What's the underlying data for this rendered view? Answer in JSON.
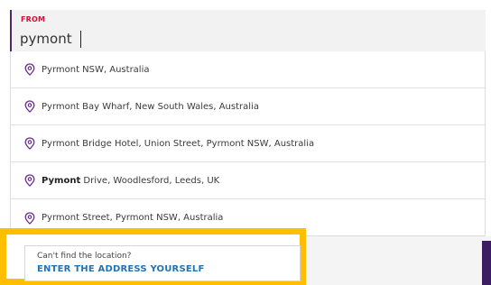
{
  "from": {
    "label": "FROM",
    "value": "pymont"
  },
  "suggestions": [
    {
      "bold": "",
      "text": "Pyrmont NSW, Australia"
    },
    {
      "bold": "",
      "text": "Pyrmont Bay Wharf, New South Wales, Australia"
    },
    {
      "bold": "",
      "text": "Pyrmont Bridge Hotel, Union Street, Pyrmont NSW, Australia"
    },
    {
      "bold": "Pymont",
      "text": " Drive, Woodlesford, Leeds, UK"
    },
    {
      "bold": "",
      "text": "Pyrmont Street, Pyrmont NSW, Australia"
    }
  ],
  "fallback": {
    "prompt": "Can't find the location?",
    "link": "ENTER THE ADDRESS YOURSELF"
  },
  "colors": {
    "label_red": "#d0113c",
    "pin_purple": "#6a2c91",
    "highlight_yellow": "#ffbf00",
    "link_blue": "#1f73b7",
    "brand_purple": "#3d1c63"
  },
  "icons": {
    "suggestion": "location-pin-icon"
  }
}
